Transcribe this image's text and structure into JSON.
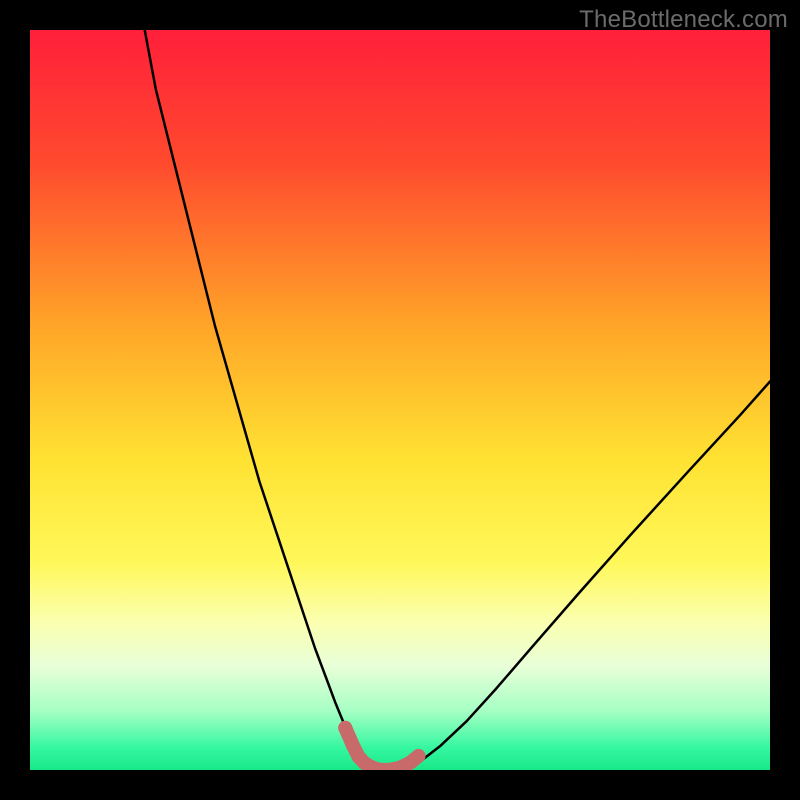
{
  "watermark": "TheBottleneck.com",
  "chart_data": {
    "type": "line",
    "title": "",
    "xlabel": "",
    "ylabel": "",
    "xlim": [
      0,
      100
    ],
    "ylim": [
      0,
      100
    ],
    "gradient_stops": [
      {
        "offset": 0,
        "color": "#ff1f3a"
      },
      {
        "offset": 0.18,
        "color": "#ff4a2e"
      },
      {
        "offset": 0.4,
        "color": "#ffa528"
      },
      {
        "offset": 0.58,
        "color": "#ffe232"
      },
      {
        "offset": 0.72,
        "color": "#fff85a"
      },
      {
        "offset": 0.8,
        "color": "#fbffb0"
      },
      {
        "offset": 0.86,
        "color": "#e8ffd8"
      },
      {
        "offset": 0.92,
        "color": "#a6ffc4"
      },
      {
        "offset": 0.97,
        "color": "#35f7a0"
      },
      {
        "offset": 1.0,
        "color": "#18e889"
      }
    ],
    "series": [
      {
        "name": "bottleneck-curve",
        "x": [
          15.5,
          17,
          19,
          21,
          23,
          25,
          27,
          29,
          31,
          33,
          35,
          37,
          38.5,
          40,
          41.3,
          42.5,
          43.5,
          44.3,
          45,
          46.2,
          47.4,
          49,
          50.8,
          52.8,
          55.5,
          59,
          63,
          68,
          74,
          81,
          89,
          96,
          100
        ],
        "y": [
          100,
          92,
          84,
          76,
          68,
          60,
          53,
          46,
          39,
          33,
          27,
          21,
          16.5,
          12.5,
          9,
          6.1,
          3.8,
          2.1,
          1.1,
          0.35,
          0,
          0,
          0.3,
          1.2,
          3.3,
          6.6,
          11,
          16.8,
          23.7,
          31.6,
          40.4,
          48,
          52.5
        ]
      },
      {
        "name": "minimum-highlight",
        "stroke": "#c96a6a",
        "stroke_width": 14,
        "dots_r": 7,
        "x": [
          42.6,
          43.6,
          44.4,
          45.2,
          46.3,
          47.3,
          48.6,
          50.0,
          51.4,
          52.5
        ],
        "y": [
          5.7,
          3.4,
          1.8,
          0.95,
          0.3,
          0.02,
          0.02,
          0.3,
          1.0,
          1.9
        ]
      }
    ]
  }
}
